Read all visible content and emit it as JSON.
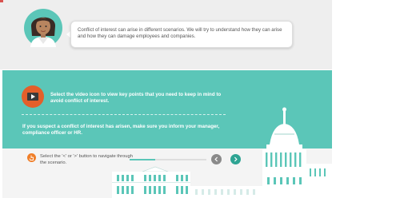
{
  "intro": {
    "text": "Conflict of interest can arise in different scenarios. We will try to understand how they can arise and how they can damage employees and companies."
  },
  "video": {
    "instruction": "Select the video icon to view key points that you need to keep in mind to avoid conflict of interest."
  },
  "notice": {
    "text": "If you suspect a conflict of interest has arisen, make sure you inform your manager, compliance officer or HR."
  },
  "navigation": {
    "instruction": "Select the '<' or '>' button to navigate through the scenario.",
    "progress_fraction": 0.33
  },
  "colors": {
    "teal": "#5bc6b8",
    "orange": "#e35f2a",
    "next_button": "#2ea493",
    "prev_button": "#8a8a8a"
  },
  "icons": {
    "avatar": "woman-avatar-icon",
    "video": "video-icon",
    "hand": "hand-pointer-icon",
    "prev": "chevron-left-icon",
    "next": "chevron-right-icon"
  }
}
